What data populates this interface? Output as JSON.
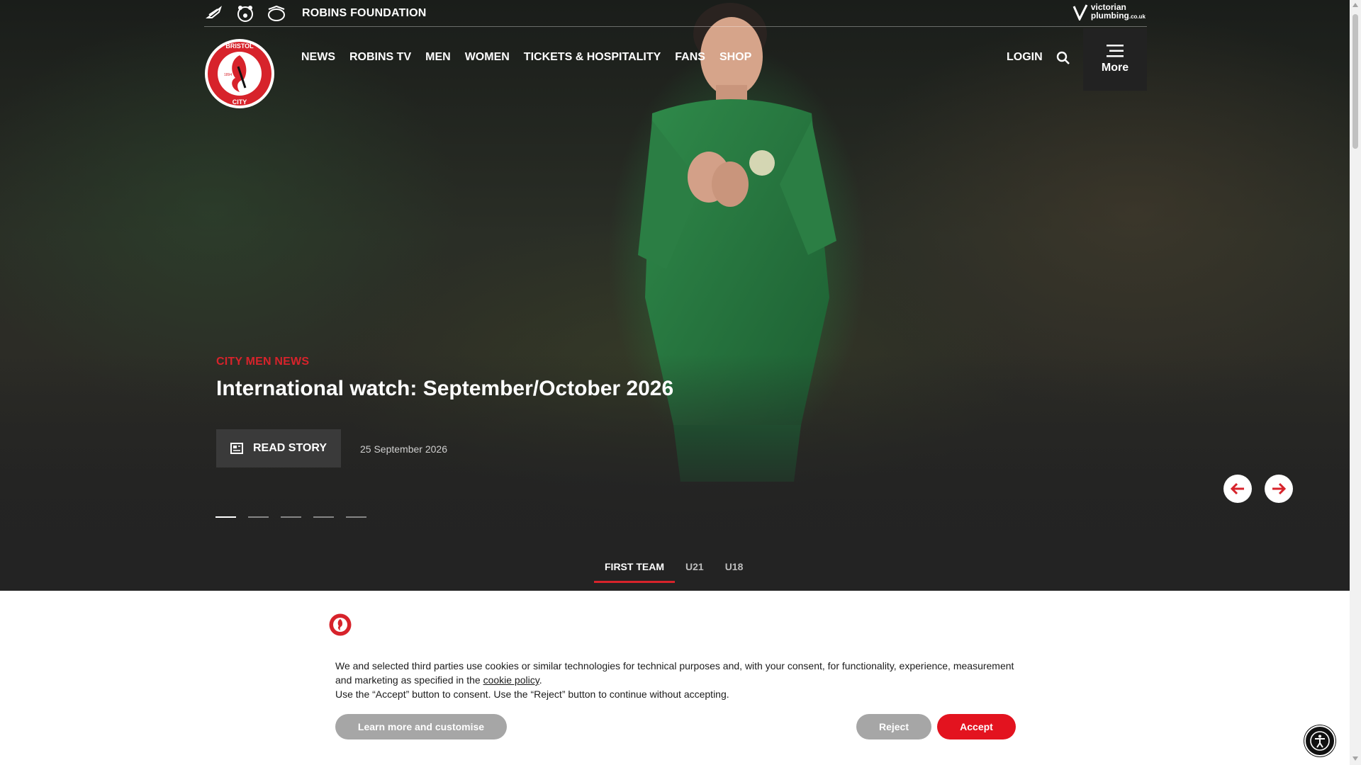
{
  "topbar": {
    "icons": [
      "robins-wing-icon",
      "bears-icon",
      "flyers-icon"
    ],
    "foundation_label": "ROBINS FOUNDATION",
    "sponsor": {
      "name": "victorian",
      "sub": "plumbing",
      "domain": ".co.uk"
    }
  },
  "nav": {
    "items": [
      "NEWS",
      "ROBINS TV",
      "MEN",
      "WOMEN",
      "TICKETS & HOSPITALITY",
      "FANS",
      "SHOP"
    ],
    "login": "LOGIN",
    "more": "More"
  },
  "crest": {
    "top_text": "BRISTOL",
    "bottom_text": "CITY",
    "year": "1894"
  },
  "hero": {
    "category": "CITY MEN NEWS",
    "headline": "International watch: September/October 2026",
    "read_label": "READ STORY",
    "date": "25 September 2026",
    "slide_count": 5,
    "active_slide": 1
  },
  "tabs": [
    {
      "label": "FIRST TEAM",
      "active": true
    },
    {
      "label": "U21",
      "active": false
    },
    {
      "label": "U18",
      "active": false
    }
  ],
  "cookie": {
    "text_before": "We and selected third parties use cookies or similar technologies for technical purposes and, with your consent, for functionality, experience, measurement and marketing as specified in the ",
    "link": "cookie policy",
    "text_after": ".",
    "line2": "Use the “Accept” button to consent. Use the “Reject” button to continue without accepting.",
    "learn_label": "Learn more and customise",
    "reject_label": "Reject",
    "accept_label": "Accept"
  },
  "colors": {
    "brand_red": "#d7232b",
    "accept_red": "#e3131f",
    "grey_button": "#a6a6a6"
  }
}
